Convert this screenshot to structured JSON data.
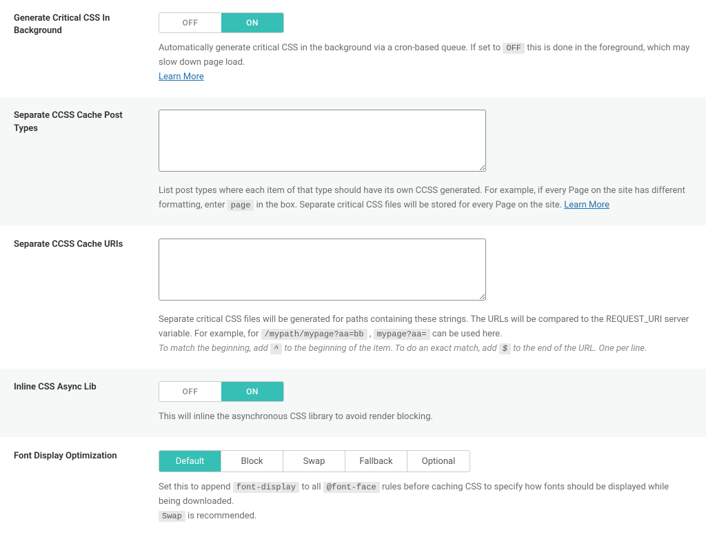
{
  "toggle": {
    "off": "OFF",
    "on": "ON"
  },
  "row1": {
    "label": "Generate Critical CSS In Background",
    "desc_a": "Automatically generate critical CSS in the background via a cron-based queue. If set to ",
    "code": "OFF",
    "desc_b": " this is done in the foreground, which may slow down page load. ",
    "learn": "Learn More"
  },
  "row2": {
    "label": "Separate CCSS Cache Post Types",
    "desc_a": "List post types where each item of that type should have its own CCSS generated. For example, if every Page on the site has different formatting, enter ",
    "code": "page",
    "desc_b": " in the box. Separate critical CSS files will be stored for every Page on the site. ",
    "learn": "Learn More"
  },
  "row3": {
    "label": "Separate CCSS Cache URIs",
    "desc_a": "Separate critical CSS files will be generated for paths containing these strings. The URLs will be compared to the REQUEST_URI server variable. For example, for ",
    "code1": "/mypath/mypage?aa=bb",
    "sep": " , ",
    "code2": "mypage?aa=",
    "desc_b": " can be used here.",
    "note_a": "To match the beginning, add ",
    "note_code1": "^",
    "note_b": " to the beginning of the item. To do an exact match, add ",
    "note_code2": "$",
    "note_c": " to the end of the URL. One per line."
  },
  "row4": {
    "label": "Inline CSS Async Lib",
    "desc": "This will inline the asynchronous CSS library to avoid render blocking."
  },
  "row5": {
    "label": "Font Display Optimization",
    "tabs": {
      "t1": "Default",
      "t2": "Block",
      "t3": "Swap",
      "t4": "Fallback",
      "t5": "Optional"
    },
    "desc_a": "Set this to append ",
    "code1": "font-display",
    "desc_b": " to all ",
    "code2": "@font-face",
    "desc_c": " rules before caching CSS to specify how fonts should be displayed while being downloaded. ",
    "code3": "Swap",
    "desc_d": " is recommended."
  }
}
